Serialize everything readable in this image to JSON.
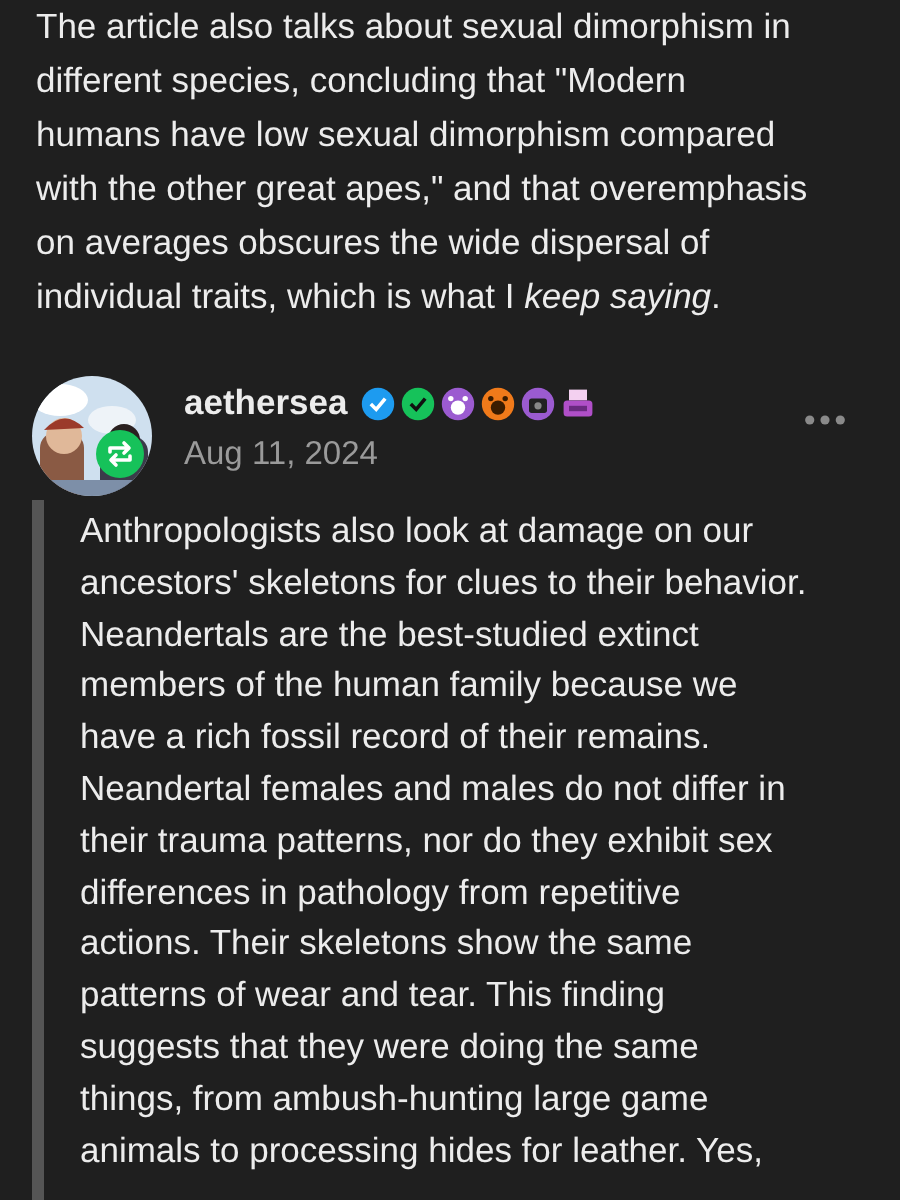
{
  "intro": {
    "lines": [
      "The article also talks about sexual dimorphism in",
      "different species, concluding that \"Modern",
      "humans have low sexual dimorphism compared",
      "with the other great apes,\" and that overemphasis",
      "on averages obscures the wide dispersal of",
      "individual traits, which is what I *keep saying*."
    ]
  },
  "reblog": {
    "username": "aethersea",
    "date": "Aug 11, 2024",
    "reblogged": true,
    "quote_lines": [
      "Anthropologists also look at damage on our",
      "ancestors' skeletons for clues to their behavior.",
      "Neandertals are the best-studied extinct",
      "members of the human family because we",
      "have a rich fossil record of their remains.",
      "Neandertal females and males do not differ in",
      "their trauma patterns, nor do they exhibit sex",
      "differences in pathology from repetitive",
      "actions. Their skeletons show the same",
      "patterns of wear and tear. This finding",
      "suggests that they were doing the same",
      "things, from ambush-hunting large game",
      "animals to processing hides for leather. Yes,"
    ]
  }
}
